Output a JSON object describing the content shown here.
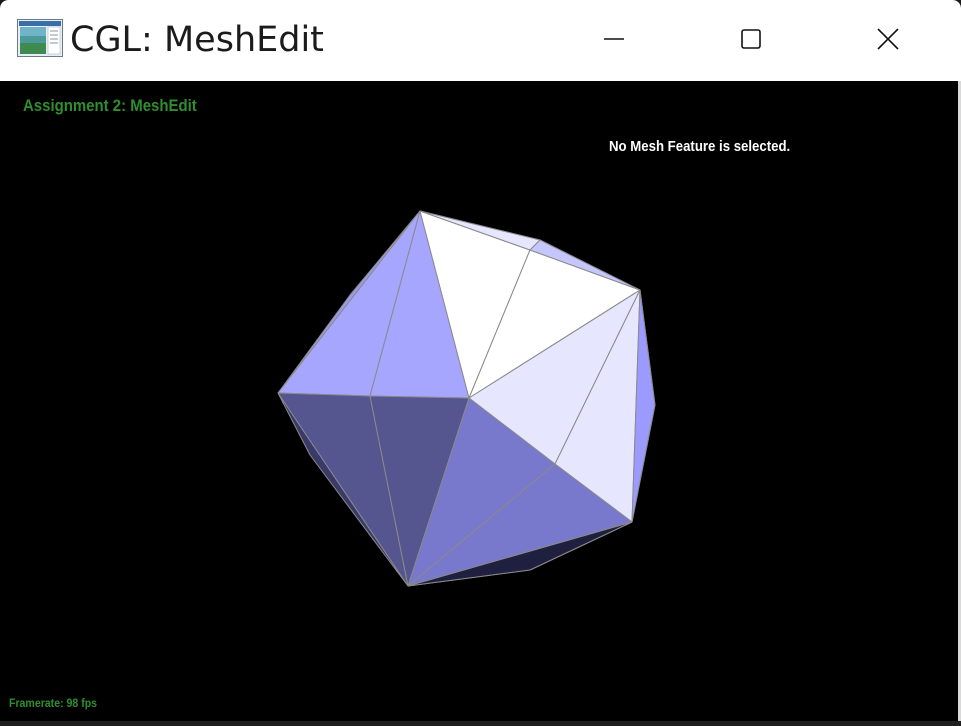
{
  "window": {
    "title": "CGL: MeshEdit",
    "controls": {
      "minimize_icon": "minimize-icon",
      "maximize_icon": "maximize-icon",
      "close_icon": "close-icon"
    }
  },
  "viewport": {
    "assignment_title": "Assignment 2: MeshEdit",
    "selection_status": "No Mesh Feature is selected.",
    "framerate": "Framerate: 98 fps"
  },
  "colors": {
    "titlebar_bg": "#ffffff",
    "viewport_bg": "#000000",
    "label_green": "#2f8f2f",
    "mesh_light": "#a6a6ff",
    "mesh_white": "#ffffff",
    "mesh_pale": "#e6e6ff",
    "mesh_mid": "#7878cc",
    "mesh_dark": "#55558f",
    "edge": "#8a8a8a"
  }
}
